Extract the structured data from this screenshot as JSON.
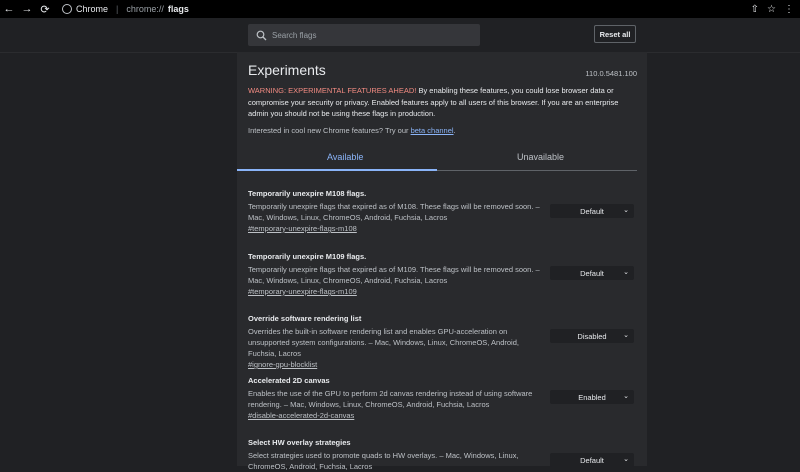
{
  "browser": {
    "back_icon": "←",
    "forward_icon": "→",
    "reload_icon": "⟳",
    "site_label": "Chrome",
    "url_prefix": "chrome://",
    "url_path": "flags",
    "share_icon": "⇧",
    "star_icon": "☆",
    "menu_icon": "⋮"
  },
  "search": {
    "placeholder": "Search flags"
  },
  "reset_label": "Reset all",
  "title": "Experiments",
  "version": "110.0.5481.100",
  "warning": {
    "highlight": "WARNING: EXPERIMENTAL FEATURES AHEAD!",
    "body": " By enabling these features, you could lose browser data or compromise your security or privacy. Enabled features apply to all users of this browser. If you are an enterprise admin you should not be using these flags in production."
  },
  "interest": {
    "text": "Interested in cool new Chrome features? Try our ",
    "link": "beta channel",
    "suffix": "."
  },
  "tabs": {
    "available": "Available",
    "unavailable": "Unavailable"
  },
  "flags": [
    {
      "name": "Temporarily unexpire M108 flags.",
      "desc": "Temporarily unexpire flags that expired as of M108. These flags will be removed soon. – Mac, Windows, Linux, ChromeOS, Android, Fuchsia, Lacros",
      "link": "#temporary-unexpire-flags-m108",
      "value": "Default"
    },
    {
      "name": "Temporarily unexpire M109 flags.",
      "desc": "Temporarily unexpire flags that expired as of M109. These flags will be removed soon. – Mac, Windows, Linux, ChromeOS, Android, Fuchsia, Lacros",
      "link": "#temporary-unexpire-flags-m109",
      "value": "Default"
    },
    {
      "name": "Override software rendering list",
      "desc": "Overrides the built-in software rendering list and enables GPU-acceleration on unsupported system configurations. – Mac, Windows, Linux, ChromeOS, Android, Fuchsia, Lacros",
      "link": "#ignore-gpu-blocklist",
      "value": "Disabled"
    },
    {
      "name": "Accelerated 2D canvas",
      "desc": "Enables the use of the GPU to perform 2d canvas rendering instead of using software rendering. – Mac, Windows, Linux, ChromeOS, Android, Fuchsia, Lacros",
      "link": "#disable-accelerated-2d-canvas",
      "value": "Enabled"
    },
    {
      "name": "Select HW overlay strategies",
      "desc": "Select strategies used to promote quads to HW overlays. – Mac, Windows, Linux, ChromeOS, Android, Fuchsia, Lacros",
      "link": "",
      "value": "Default"
    }
  ]
}
